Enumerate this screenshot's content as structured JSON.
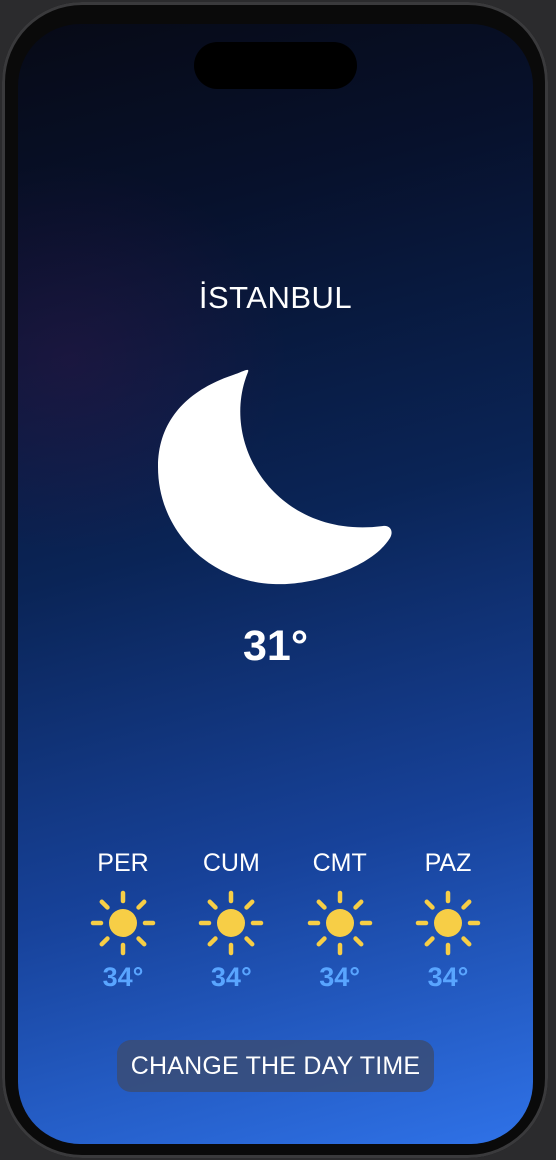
{
  "city": "İSTANBUL",
  "current": {
    "icon": "moon-icon",
    "temperature": "31°"
  },
  "forecast": [
    {
      "day": "PER",
      "icon": "sun-icon",
      "temperature": "34°"
    },
    {
      "day": "CUM",
      "icon": "sun-icon",
      "temperature": "34°"
    },
    {
      "day": "CMT",
      "icon": "sun-icon",
      "temperature": "34°"
    },
    {
      "day": "PAZ",
      "icon": "sun-icon",
      "temperature": "34°"
    }
  ],
  "button": {
    "label": "CHANGE THE DAY TIME"
  },
  "colors": {
    "sun": "#f7ce46",
    "forecast_temp": "#59a5ff",
    "gradient_top": "#070a16",
    "gradient_bottom": "#2f72e8"
  }
}
